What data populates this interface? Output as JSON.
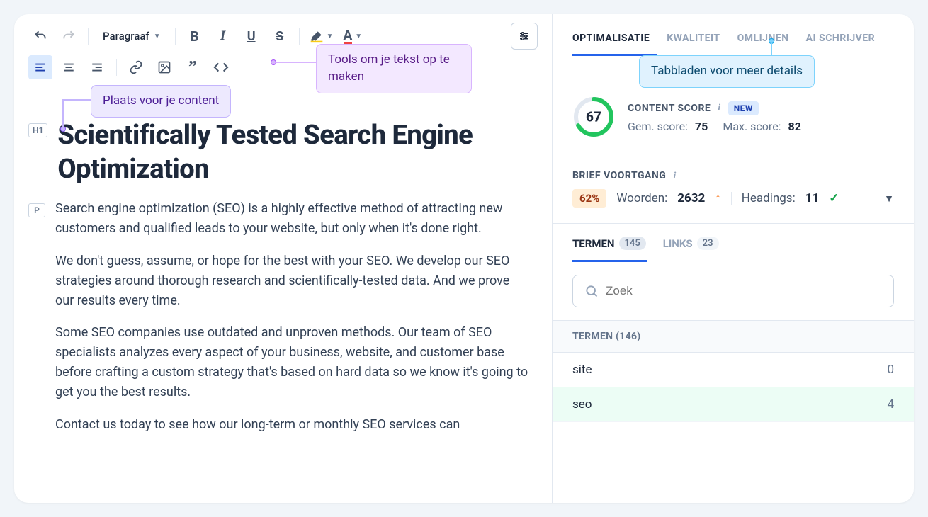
{
  "toolbar": {
    "block_type": "Paragraaf",
    "callout_tools": "Tools om je tekst op te maken",
    "callout_content": "Plaats voor je content"
  },
  "document": {
    "h1": "Scientifically Tested Search Engine Optimization",
    "paragraphs": [
      "Search engine optimization (SEO) is a highly effective method of attracting new customers and qualified leads to your website, but only when it's done right.",
      "We don't guess, assume, or hope for the best with your SEO. We develop our SEO strategies around thorough research and scientifically-tested data. And we prove our results every time.",
      "Some SEO companies use outdated and unproven methods. Our team of SEO specialists analyzes every aspect of your business, website, and customer base before crafting a custom strategy that's based on hard data so we know it's going to get you the best results.",
      "Contact us today to see how our long-term or monthly SEO services can"
    ]
  },
  "tabs": {
    "items": [
      "OPTIMALISATIE",
      "KWALITEIT",
      "OMLIJNEN",
      "AI SCHRIJVER"
    ],
    "callout": "Tabbladen voor meer details"
  },
  "score": {
    "label": "CONTENT SCORE",
    "value": 67,
    "badge": "NEW",
    "avg_label": "Gem. score:",
    "avg_value": 75,
    "max_label": "Max. score:",
    "max_value": 82
  },
  "brief": {
    "label": "BRIEF VOORTGANG",
    "percent": "62%",
    "words_label": "Woorden:",
    "words_value": 2632,
    "headings_label": "Headings:",
    "headings_value": 11
  },
  "terms": {
    "tab_terms": "TERMEN",
    "tab_terms_count": 145,
    "tab_links": "LINKS",
    "tab_links_count": 23,
    "search_placeholder": "Zoek",
    "list_header": "TERMEN (146)",
    "rows": [
      {
        "term": "site",
        "count": 0,
        "hl": false
      },
      {
        "term": "seo",
        "count": 4,
        "hl": true
      }
    ]
  }
}
